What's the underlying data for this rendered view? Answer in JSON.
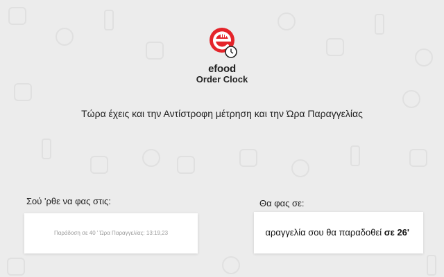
{
  "app": {
    "brand": "efood",
    "subtitle": "Order Clock",
    "accent": "#e4242a"
  },
  "headline": "Τώρα έχεις και την Αντίστροφη μέτρηση και την Ώρα Παραγγελίας",
  "left_panel": {
    "label": "Σού 'ρθε να φας στις:",
    "detail": "Παράδοση σε 40 '   Ώρα Παραγγελίας: 13:19,23"
  },
  "right_panel": {
    "label": "Θα φας σε:",
    "message_prefix": "αραγγελία σου θα παραδοθεί ",
    "message_emphasis": "σε 26'"
  },
  "icons": {
    "logo": "efood-logo-icon",
    "clock": "clock-badge-icon"
  }
}
